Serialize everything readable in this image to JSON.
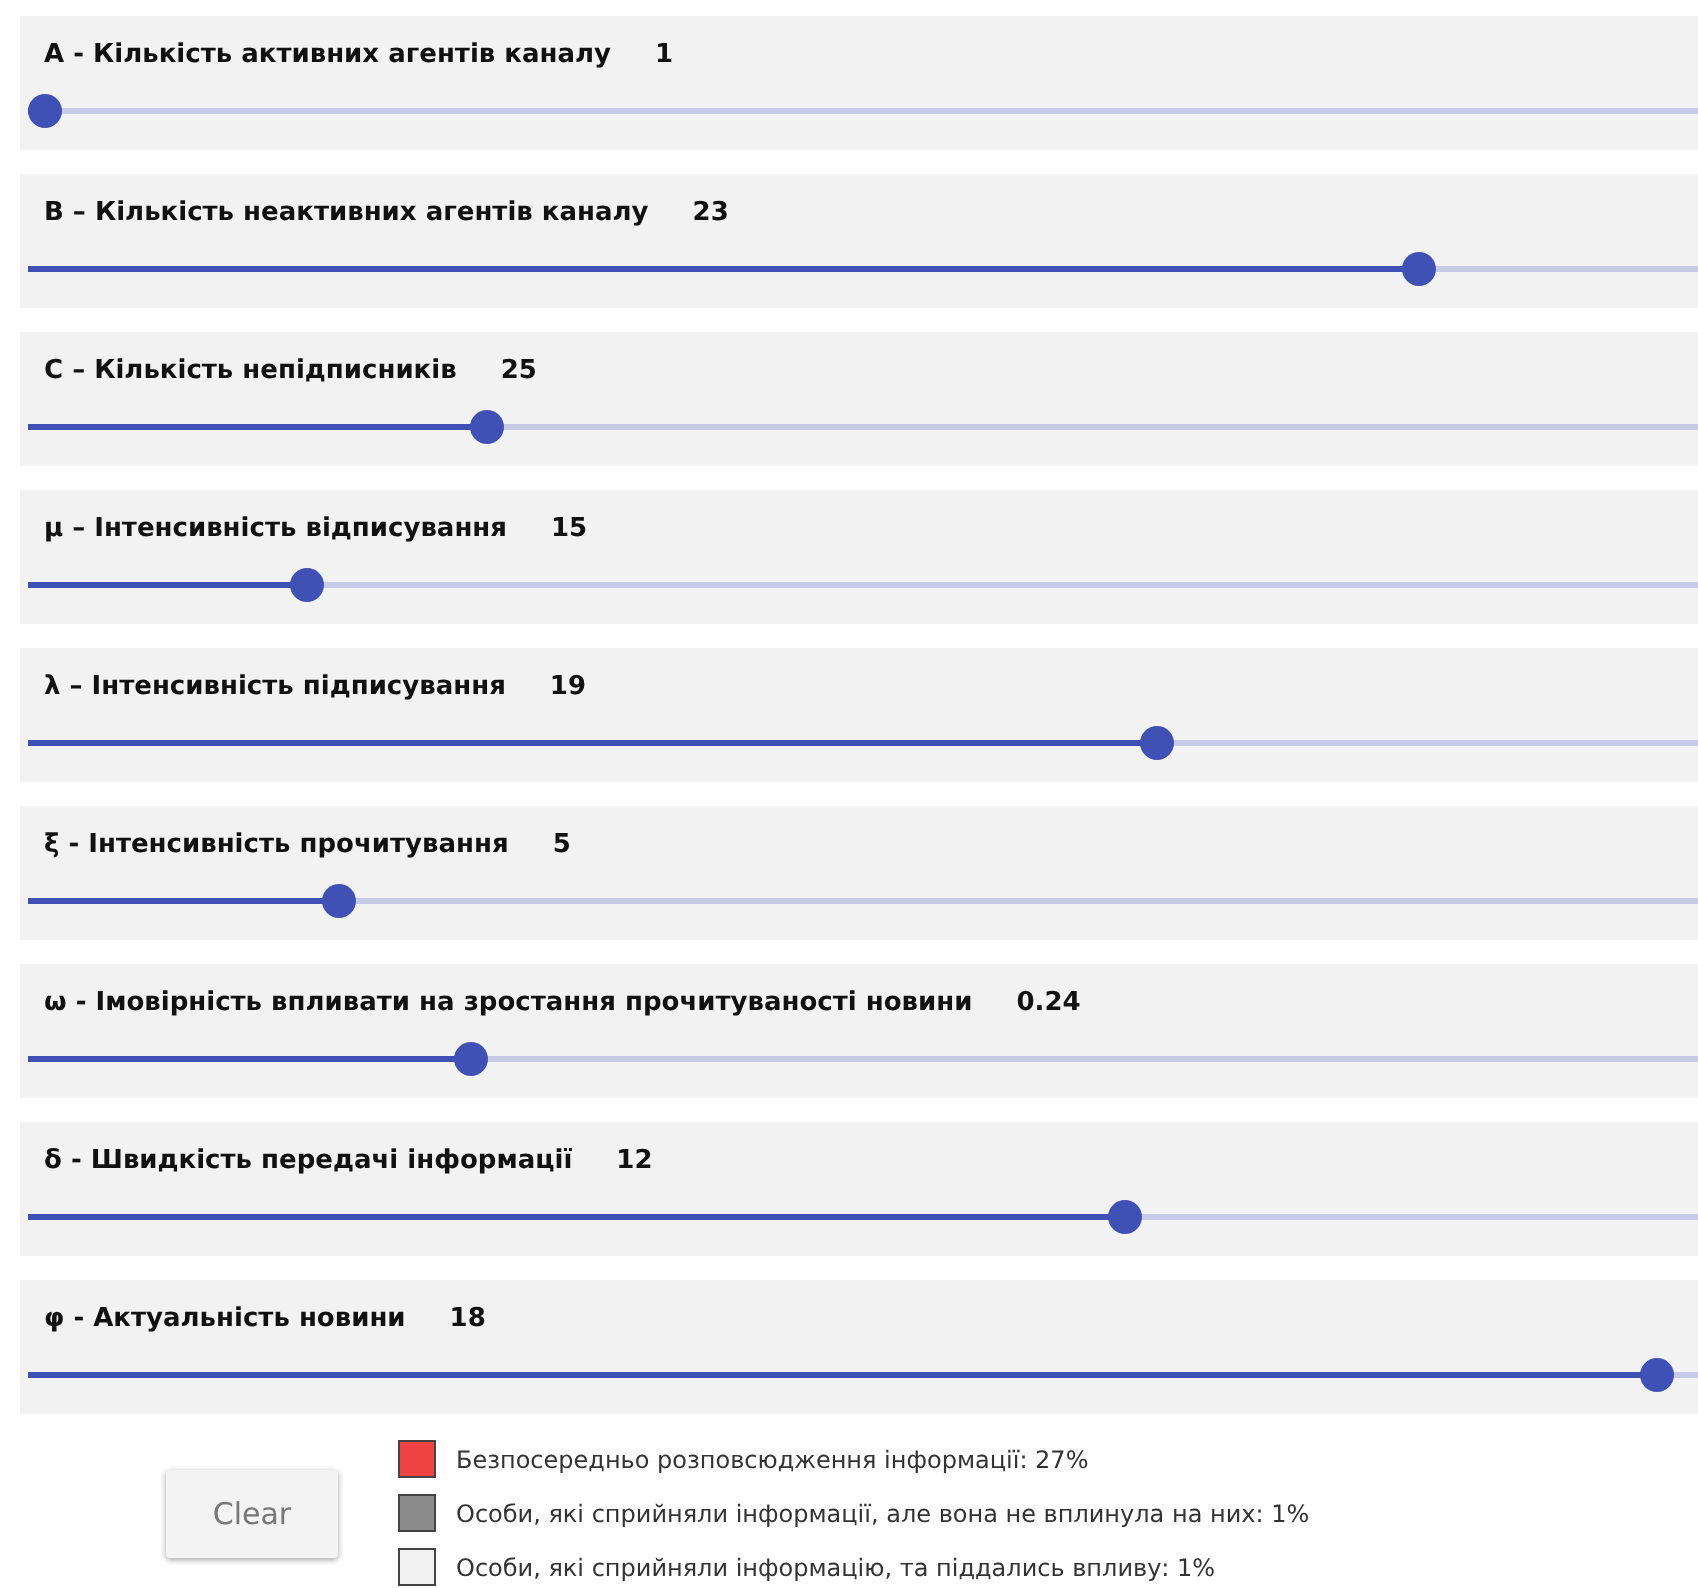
{
  "sliders": [
    {
      "label": "A - Кількість активних агентів каналу",
      "value": "1",
      "level": 0.0
    },
    {
      "label": "B – Кількість неактивних агентів каналу",
      "value": "23",
      "level": 0.84
    },
    {
      "label": "C – Кількість непідписників",
      "value": "25",
      "level": 0.27
    },
    {
      "label": "μ – Інтенсивність відписування",
      "value": "15",
      "level": 0.16
    },
    {
      "label": "λ – Інтенсивність підписування",
      "value": "19",
      "level": 0.68
    },
    {
      "label": "ξ - Інтенсивність прочитування",
      "value": "5",
      "level": 0.18
    },
    {
      "label": "ω - Імовірність впливати на зростання прочитуваності новини",
      "value": "0.24",
      "level": 0.26
    },
    {
      "label": "δ - Швидкість передачі інформації",
      "value": "12",
      "level": 0.66
    },
    {
      "label": "φ - Актуальність новини",
      "value": "18",
      "level": 0.985
    }
  ],
  "clear_button": "Clear",
  "legend": [
    {
      "text": "Безпосередньо розповсюдження інформації: 27%",
      "color": "#f04444"
    },
    {
      "text": "Особи, які сприйняли інформації, але вона не вплинула на них: 1%",
      "color": "#8c8c8c"
    },
    {
      "text": "Особи, які сприйняли інформацію, та піддались впливу: 1%",
      "color": "#f2f2f2"
    }
  ]
}
